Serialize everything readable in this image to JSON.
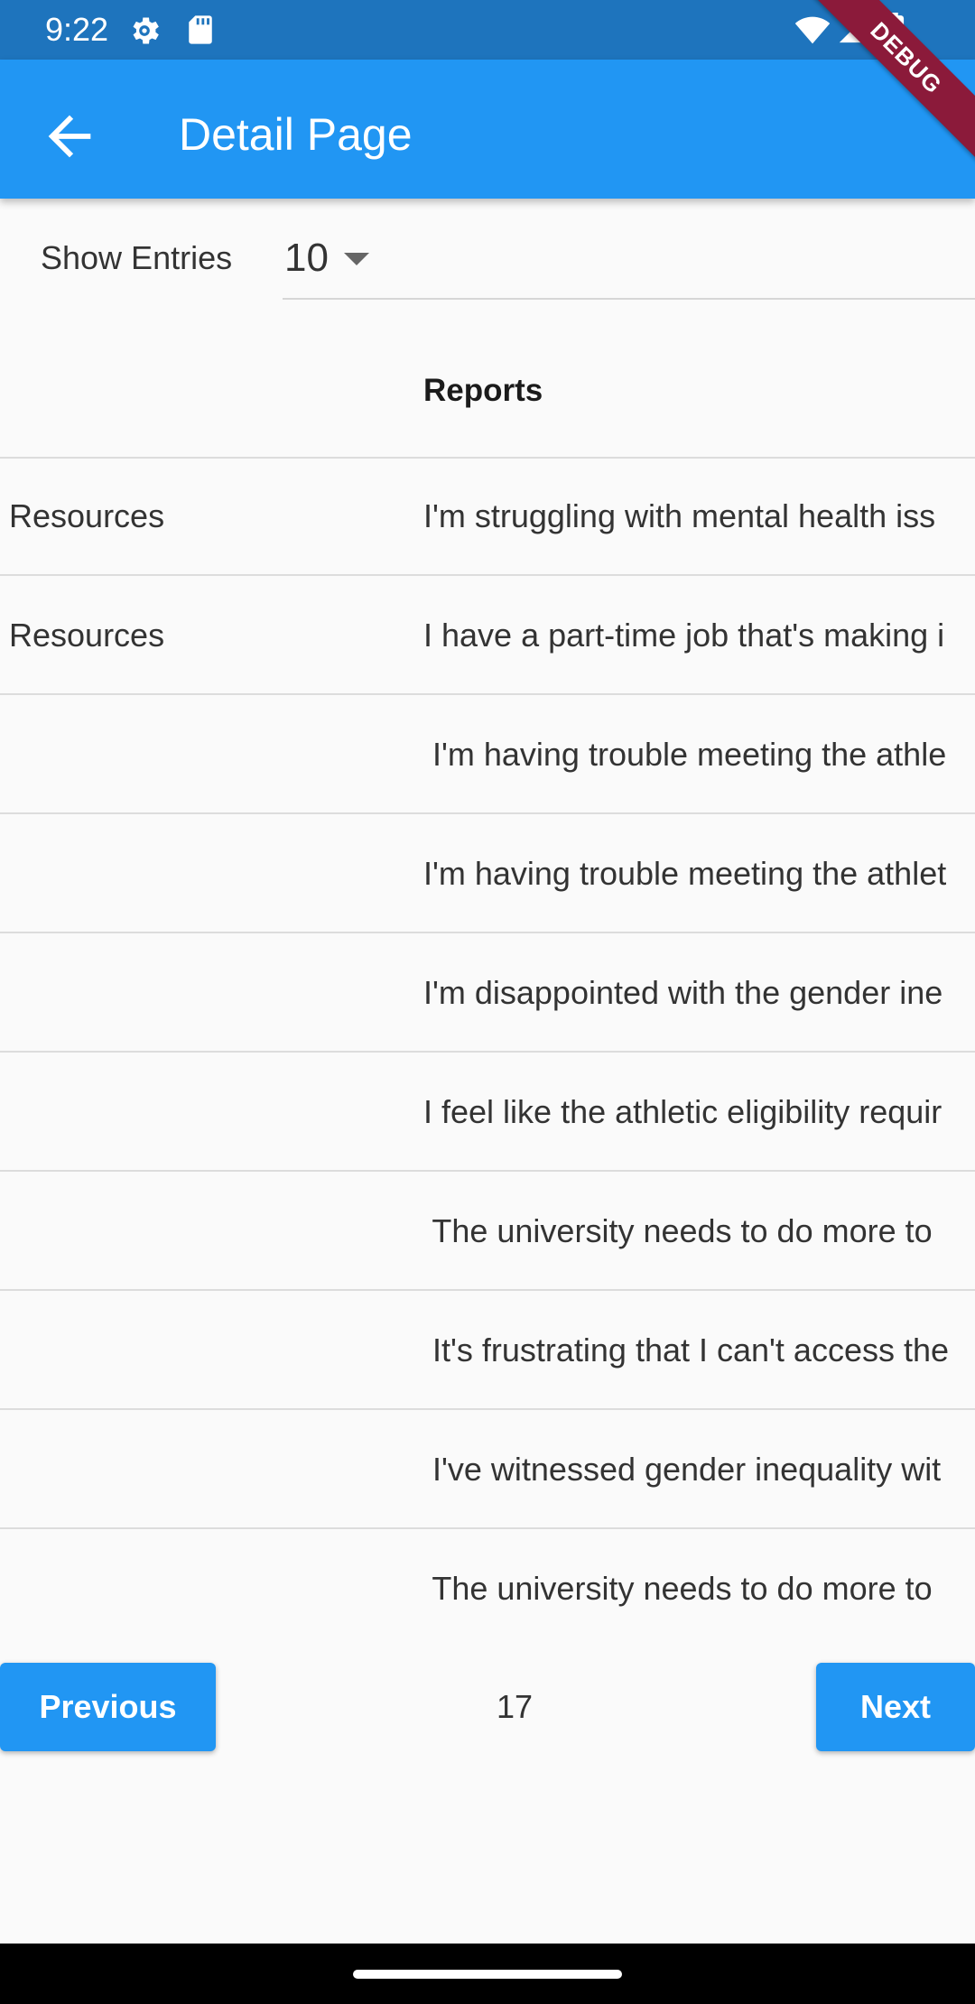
{
  "status_bar": {
    "time": "9:22"
  },
  "app_bar": {
    "title": "Detail Page"
  },
  "debug_banner": "DEBUG",
  "entries": {
    "label": "Show Entries",
    "value": "10"
  },
  "table": {
    "header": "Reports",
    "rows": [
      {
        "category": "Resources",
        "report": "I'm struggling with mental health iss"
      },
      {
        "category": "Resources",
        "report": "I have a part-time job that's making i"
      },
      {
        "category": "",
        "report": " I'm having trouble meeting the athle"
      },
      {
        "category": "",
        "report": "I'm having trouble meeting the athlet"
      },
      {
        "category": "",
        "report": "I'm disappointed with the gender ine"
      },
      {
        "category": "",
        "report": "I feel like the athletic eligibility requir"
      },
      {
        "category": "",
        "report": " The university needs to do more to"
      },
      {
        "category": "",
        "report": " It's frustrating that I can't access the"
      },
      {
        "category": "",
        "report": " I've witnessed gender inequality wit"
      },
      {
        "category": "",
        "report": " The university needs to do more to"
      }
    ]
  },
  "pagination": {
    "previous_label": "Previous",
    "page": "17",
    "next_label": "Next"
  }
}
